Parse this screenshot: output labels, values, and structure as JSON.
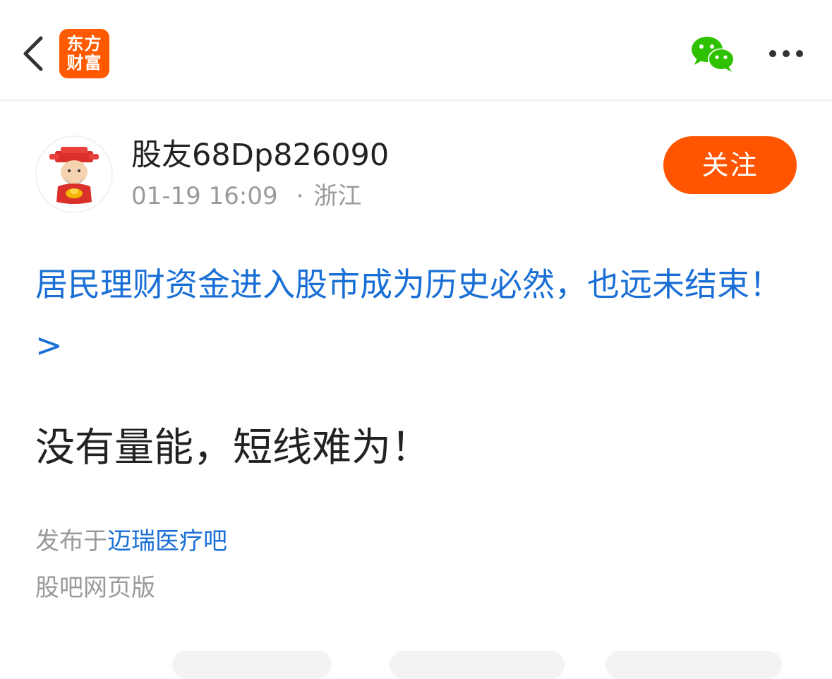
{
  "header": {
    "logo_line1": "东方",
    "logo_line2": "财富",
    "icons": [
      "back-arrow-icon",
      "wechat-icon",
      "more-dots-icon"
    ]
  },
  "author": {
    "name": "股友68Dp826090",
    "time": "01-19 16:09",
    "separator": "·",
    "location": "浙江",
    "follow_label": "关注"
  },
  "post": {
    "topic_link": "居民理财资金进入股市成为历史必然，也远未结束！ >",
    "body": "没有量能，短线难为！",
    "published_prefix": "发布于",
    "bar_name": "迈瑞医疗吧",
    "web_version": "股吧网页版"
  },
  "colors": {
    "brand": "#ff5a00",
    "follow": "#ff5500",
    "link": "#1a6fd6",
    "wechat": "#2dc100",
    "muted": "#9a9a9a"
  }
}
